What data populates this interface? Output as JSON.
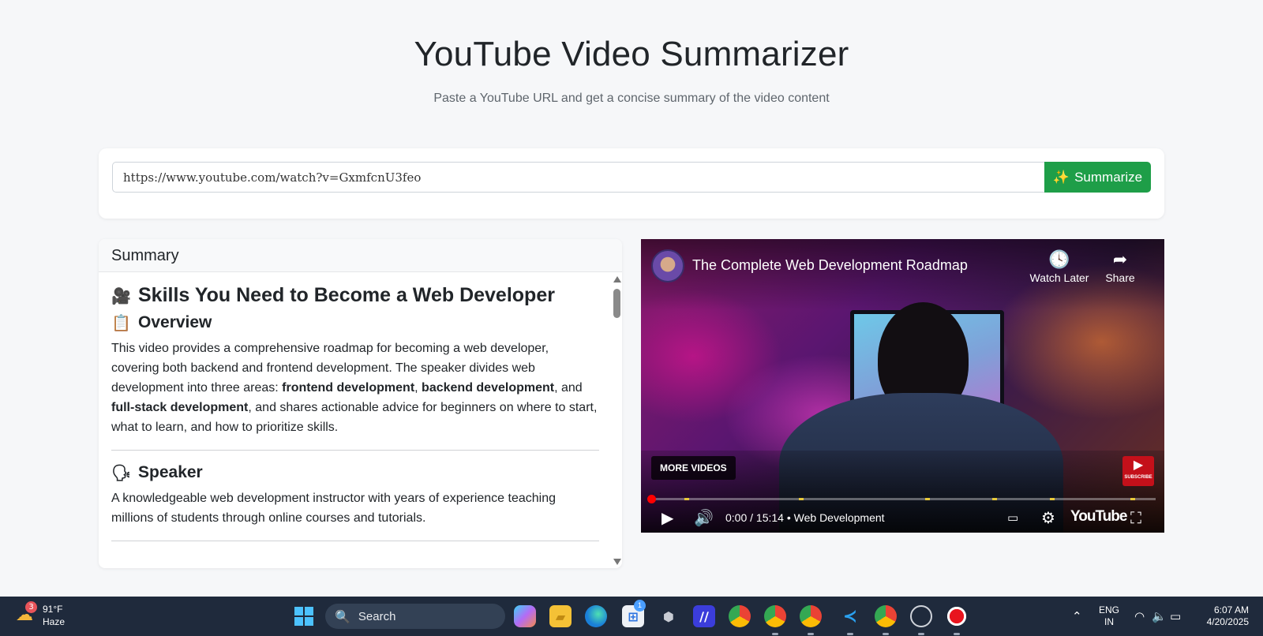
{
  "header": {
    "title": "YouTube Video Summarizer",
    "subtitle": "Paste a YouTube URL and get a concise summary of the video content"
  },
  "form": {
    "url_value": "https://www.youtube.com/watch?v=GxmfcnU3feo",
    "button_icon": "✨",
    "button_label": "Summarize"
  },
  "summary": {
    "header": "Summary",
    "title_emoji": "🎥",
    "title": "Skills You Need to Become a Web Developer",
    "sections": [
      {
        "emoji": "📋",
        "heading": "Overview",
        "text_parts": [
          "This video provides a comprehensive roadmap for becoming a web developer, covering both backend and frontend development. The speaker divides web development into three areas: ",
          "frontend development",
          ", ",
          "backend development",
          ", and ",
          "full-stack development",
          ", and shares actionable advice for beginners on where to start, what to learn, and how to prioritize skills."
        ]
      },
      {
        "emoji": "🗣",
        "heading": "Speaker",
        "text": "A knowledgeable web development instructor with years of experience teaching millions of students through online courses and tutorials."
      }
    ]
  },
  "video": {
    "title": "The Complete Web Development Roadmap",
    "watch_later": "Watch Later",
    "share": "Share",
    "more_videos": "MORE VIDEOS",
    "subscribe": "SUBSCRIBE",
    "time": "0:00 / 15:14",
    "separator": "•",
    "chapter": "Web Development",
    "logo": "YouTube",
    "progress": 0
  },
  "taskbar": {
    "weather_temp": "91°F",
    "weather_desc": "Haze",
    "weather_badge": "3",
    "search_placeholder": "Search",
    "store_badge": "1",
    "lang_line1": "ENG",
    "lang_line2": "IN",
    "time": "6:07 AM",
    "date": "4/20/2025"
  },
  "colors": {
    "accent_green": "#1e9e48",
    "youtube_red": "#ff0000",
    "taskbar": "#1f2a3c"
  }
}
